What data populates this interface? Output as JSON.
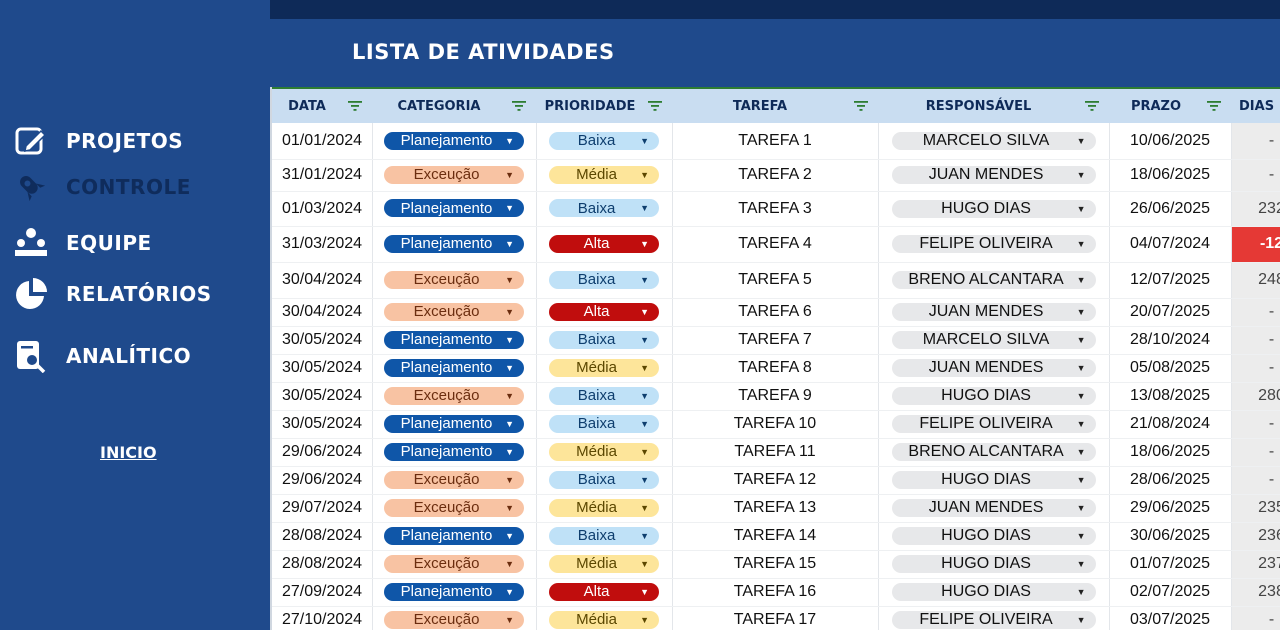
{
  "sidebar": {
    "items": [
      {
        "label": "PROJETOS",
        "icon": "edit-icon"
      },
      {
        "label": "CONTROLE",
        "icon": "rocket-icon"
      },
      {
        "label": "EQUIPE",
        "icon": "team-icon"
      },
      {
        "label": "RELATÓRIOS",
        "icon": "pie-chart-icon"
      },
      {
        "label": "ANALÍTICO",
        "icon": "search-document-icon"
      }
    ],
    "inicio": "INICIO"
  },
  "page": {
    "title": "LISTA DE ATIVIDADES"
  },
  "colors": {
    "sidebar_bg": "#1f4a8c",
    "topbar_bg": "#0e2a58",
    "header_bg": "#c9ddf1",
    "planejamento": "#0f56a8",
    "execucao": "#f8c3a3",
    "baixa": "#bfe1f7",
    "media": "#fde59a",
    "alta": "#c00d0d",
    "negative_days": "#e53935"
  },
  "table": {
    "columns": [
      "DATA",
      "CATEGORIA",
      "PRIORIDADE",
      "TAREFA",
      "RESPONSÁVEL",
      "PRAZO",
      "DIAS"
    ],
    "rows": [
      {
        "data": "01/01/2024",
        "categoria": "Planejamento",
        "prioridade": "Baixa",
        "tarefa": "TAREFA 1",
        "responsavel": "MARCELO SILVA",
        "prazo": "10/06/2025",
        "dias": "-"
      },
      {
        "data": "31/01/2024",
        "categoria": "Exceução",
        "prioridade": "Média",
        "tarefa": "TAREFA 2",
        "responsavel": "JUAN MENDES",
        "prazo": "18/06/2025",
        "dias": "-"
      },
      {
        "data": "01/03/2024",
        "categoria": "Planejamento",
        "prioridade": "Baixa",
        "tarefa": "TAREFA 3",
        "responsavel": "HUGO DIAS",
        "prazo": "26/06/2025",
        "dias": "232"
      },
      {
        "data": "31/03/2024",
        "categoria": "Planejamento",
        "prioridade": "Alta",
        "tarefa": "TAREFA 4",
        "responsavel": "FELIPE OLIVEIRA",
        "prazo": "04/07/2024",
        "dias": "-12"
      },
      {
        "data": "30/04/2024",
        "categoria": "Exceução",
        "prioridade": "Baixa",
        "tarefa": "TAREFA 5",
        "responsavel": "BRENO ALCANTARA",
        "prazo": "12/07/2025",
        "dias": "248"
      },
      {
        "data": "30/04/2024",
        "categoria": "Exceução",
        "prioridade": "Alta",
        "tarefa": "TAREFA 6",
        "responsavel": "JUAN MENDES",
        "prazo": "20/07/2025",
        "dias": "-"
      },
      {
        "data": "30/05/2024",
        "categoria": "Planejamento",
        "prioridade": "Baixa",
        "tarefa": "TAREFA 7",
        "responsavel": "MARCELO SILVA",
        "prazo": "28/10/2024",
        "dias": "-"
      },
      {
        "data": "30/05/2024",
        "categoria": "Planejamento",
        "prioridade": "Média",
        "tarefa": "TAREFA 8",
        "responsavel": "JUAN MENDES",
        "prazo": "05/08/2025",
        "dias": "-"
      },
      {
        "data": "30/05/2024",
        "categoria": "Exceução",
        "prioridade": "Baixa",
        "tarefa": "TAREFA 9",
        "responsavel": "HUGO DIAS",
        "prazo": "13/08/2025",
        "dias": "280"
      },
      {
        "data": "30/05/2024",
        "categoria": "Planejamento",
        "prioridade": "Baixa",
        "tarefa": "TAREFA 10",
        "responsavel": "FELIPE OLIVEIRA",
        "prazo": "21/08/2024",
        "dias": "-"
      },
      {
        "data": "29/06/2024",
        "categoria": "Planejamento",
        "prioridade": "Média",
        "tarefa": "TAREFA 11",
        "responsavel": "BRENO ALCANTARA",
        "prazo": "18/06/2025",
        "dias": "-"
      },
      {
        "data": "29/06/2024",
        "categoria": "Exceução",
        "prioridade": "Baixa",
        "tarefa": "TAREFA 12",
        "responsavel": "HUGO DIAS",
        "prazo": "28/06/2025",
        "dias": "-"
      },
      {
        "data": "29/07/2024",
        "categoria": "Exceução",
        "prioridade": "Média",
        "tarefa": "TAREFA 13",
        "responsavel": "JUAN MENDES",
        "prazo": "29/06/2025",
        "dias": "235"
      },
      {
        "data": "28/08/2024",
        "categoria": "Planejamento",
        "prioridade": "Baixa",
        "tarefa": "TAREFA 14",
        "responsavel": "HUGO DIAS",
        "prazo": "30/06/2025",
        "dias": "236"
      },
      {
        "data": "28/08/2024",
        "categoria": "Exceução",
        "prioridade": "Média",
        "tarefa": "TAREFA 15",
        "responsavel": "HUGO DIAS",
        "prazo": "01/07/2025",
        "dias": "237"
      },
      {
        "data": "27/09/2024",
        "categoria": "Planejamento",
        "prioridade": "Alta",
        "tarefa": "TAREFA 16",
        "responsavel": "HUGO DIAS",
        "prazo": "02/07/2025",
        "dias": "238"
      },
      {
        "data": "27/10/2024",
        "categoria": "Exceução",
        "prioridade": "Média",
        "tarefa": "TAREFA 17",
        "responsavel": "FELIPE OLIVEIRA",
        "prazo": "03/07/2025",
        "dias": "-"
      }
    ]
  }
}
